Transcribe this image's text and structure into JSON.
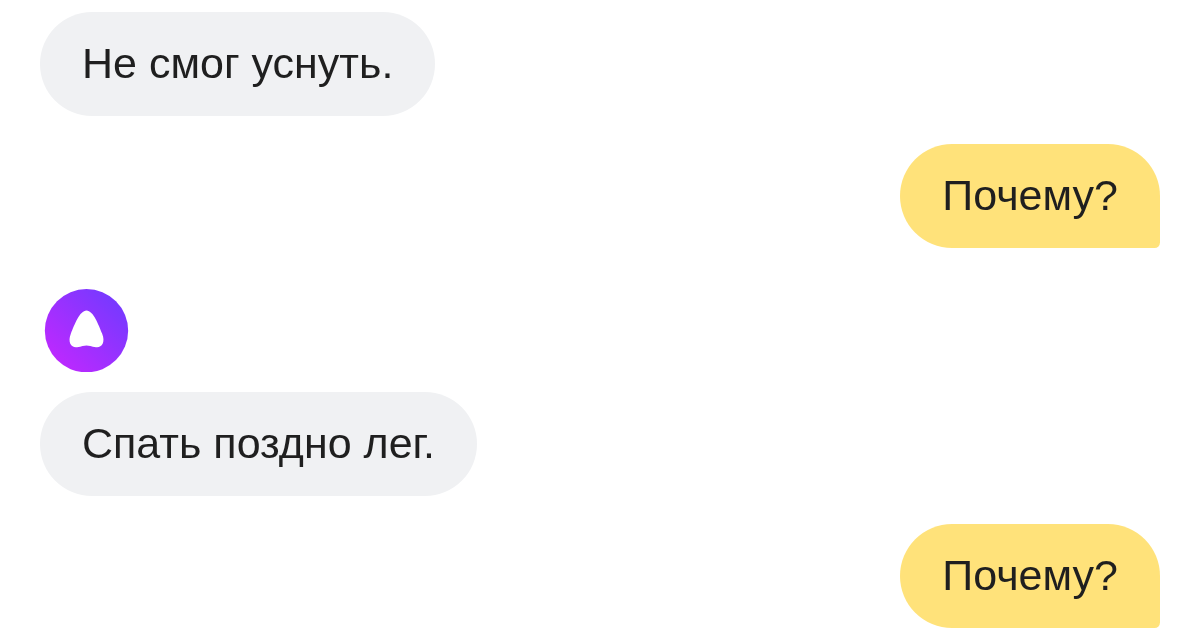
{
  "messages": [
    {
      "kind": "bot",
      "text": "Не смог уснуть."
    },
    {
      "kind": "user",
      "text": "Почему?"
    },
    {
      "kind": "avatar"
    },
    {
      "kind": "bot",
      "text": "Спать поздно лег."
    },
    {
      "kind": "user",
      "text": "Почему?"
    }
  ]
}
